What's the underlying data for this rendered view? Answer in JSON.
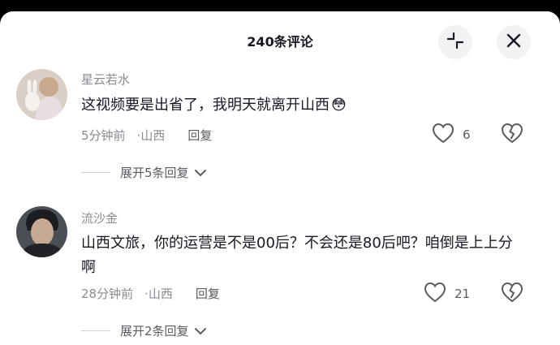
{
  "header": {
    "title": "240条评论",
    "collapse_icon": "collapse-arrows-icon",
    "close_icon": "close-icon"
  },
  "comments": [
    {
      "username": "星云若水",
      "text": "这视频要是出省了，我明天就离开山西",
      "emoji": "😳",
      "time": "5分钟前",
      "location": "山西",
      "reply_label": "回复",
      "likes": "6",
      "expand_label": "展开5条回复"
    },
    {
      "username": "流沙金",
      "text": "山西文旅，你的运营是不是00后？不会还是80后吧？咱倒是上上分啊",
      "time": "28分钟前",
      "location": "山西",
      "reply_label": "回复",
      "likes": "21",
      "expand_label": "展开2条回复"
    }
  ],
  "meta_separator": "·",
  "colors": {
    "primary_text": "#161823",
    "secondary_text": "#8a8b91",
    "button_bg": "#f2f2f4"
  }
}
